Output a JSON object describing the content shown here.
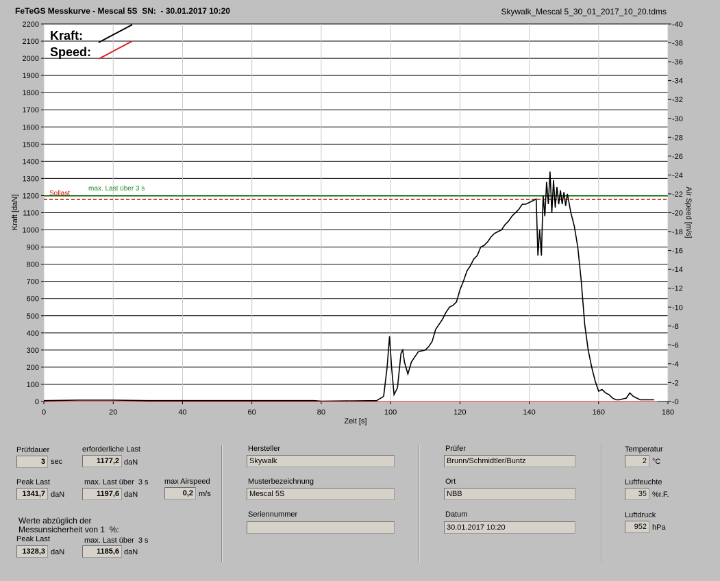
{
  "header": {
    "title": "FeTeGS Messkurve - Mescal 5S  SN:  - 30.01.2017 10:20",
    "filename": "Skywalk_Mescal 5_30_01_2017_10_20.tdms"
  },
  "chart_data": {
    "type": "line",
    "xlabel": "Zeit [s]",
    "ylabel": "Kraft [daN]",
    "y2label": "Air Speed [m/s]",
    "xlim": [
      0,
      180
    ],
    "ylim": [
      0,
      2200
    ],
    "y2lim": [
      0,
      40
    ],
    "x_ticks": [
      0,
      20,
      40,
      60,
      80,
      100,
      120,
      140,
      160,
      180
    ],
    "y_ticks": [
      0,
      100,
      200,
      300,
      400,
      500,
      600,
      700,
      800,
      900,
      1000,
      1100,
      1200,
      1300,
      1400,
      1500,
      1600,
      1700,
      1800,
      1900,
      2000,
      2100,
      2200
    ],
    "y2_ticks": [
      0,
      2,
      4,
      6,
      8,
      10,
      12,
      14,
      16,
      18,
      20,
      22,
      24,
      26,
      28,
      30,
      32,
      34,
      36,
      38,
      40
    ],
    "grid": true,
    "legend": {
      "entries": [
        {
          "label": "Kraft:",
          "color": "#000000"
        },
        {
          "label": "Speed:",
          "color": "#e02020"
        }
      ],
      "placement": "top-left"
    },
    "reference_lines": [
      {
        "label": "Sollast",
        "value": 1177.2,
        "color": "#cc1111",
        "style": "dashed"
      },
      {
        "label": "max. Last über  3 s",
        "value": 1197.6,
        "color": "#1a8a1a",
        "style": "solid"
      }
    ],
    "series": [
      {
        "name": "Kraft",
        "color": "#000000",
        "points": [
          [
            0,
            5
          ],
          [
            10,
            8
          ],
          [
            20,
            8
          ],
          [
            30,
            5
          ],
          [
            40,
            5
          ],
          [
            60,
            5
          ],
          [
            78,
            5
          ],
          [
            80,
            2
          ],
          [
            96,
            5
          ],
          [
            98,
            30
          ],
          [
            99,
            200
          ],
          [
            99.7,
            380
          ],
          [
            100.3,
            200
          ],
          [
            101,
            40
          ],
          [
            102,
            80
          ],
          [
            103,
            280
          ],
          [
            103.5,
            300
          ],
          [
            104,
            230
          ],
          [
            105,
            160
          ],
          [
            106,
            230
          ],
          [
            107,
            260
          ],
          [
            108,
            290
          ],
          [
            110,
            300
          ],
          [
            111,
            320
          ],
          [
            112,
            350
          ],
          [
            113,
            420
          ],
          [
            114,
            450
          ],
          [
            115,
            480
          ],
          [
            116,
            520
          ],
          [
            117,
            550
          ],
          [
            118,
            560
          ],
          [
            119,
            580
          ],
          [
            120,
            650
          ],
          [
            121,
            700
          ],
          [
            122,
            760
          ],
          [
            123,
            790
          ],
          [
            124,
            830
          ],
          [
            125,
            850
          ],
          [
            126,
            900
          ],
          [
            127,
            910
          ],
          [
            128,
            930
          ],
          [
            129,
            960
          ],
          [
            130,
            980
          ],
          [
            131,
            990
          ],
          [
            132,
            1000
          ],
          [
            133,
            1030
          ],
          [
            134,
            1050
          ],
          [
            135,
            1080
          ],
          [
            136,
            1100
          ],
          [
            137,
            1120
          ],
          [
            138,
            1150
          ],
          [
            139,
            1150
          ],
          [
            140,
            1160
          ],
          [
            141,
            1170
          ],
          [
            142,
            1180
          ],
          [
            142.5,
            850
          ],
          [
            143,
            1000
          ],
          [
            143.5,
            850
          ],
          [
            144,
            1200
          ],
          [
            144.5,
            1080
          ],
          [
            145,
            1280
          ],
          [
            145.5,
            1150
          ],
          [
            146,
            1340
          ],
          [
            146.5,
            1100
          ],
          [
            147,
            1290
          ],
          [
            147.5,
            1130
          ],
          [
            148,
            1250
          ],
          [
            148.5,
            1150
          ],
          [
            149,
            1230
          ],
          [
            149.5,
            1150
          ],
          [
            150,
            1220
          ],
          [
            150.5,
            1140
          ],
          [
            151,
            1210
          ],
          [
            152,
            1100
          ],
          [
            153,
            1020
          ],
          [
            154,
            900
          ],
          [
            155,
            700
          ],
          [
            156,
            450
          ],
          [
            157,
            300
          ],
          [
            158,
            200
          ],
          [
            159,
            120
          ],
          [
            160,
            60
          ],
          [
            161,
            70
          ],
          [
            162,
            50
          ],
          [
            163,
            40
          ],
          [
            164,
            20
          ],
          [
            165,
            10
          ],
          [
            166,
            10
          ],
          [
            168,
            20
          ],
          [
            169,
            50
          ],
          [
            170,
            30
          ],
          [
            171,
            20
          ],
          [
            172,
            10
          ],
          [
            176,
            10
          ]
        ]
      },
      {
        "name": "Speed",
        "color": "#e02020",
        "points": [
          [
            0,
            0
          ],
          [
            177,
            0
          ]
        ]
      }
    ]
  },
  "panel": {
    "pruefdauer": {
      "label": "Prüfdauer",
      "value": "3",
      "unit": "sec"
    },
    "erf_last": {
      "label": "erforderliche Last",
      "value": "1177,2",
      "unit": "daN"
    },
    "peak_last": {
      "label": "Peak Last",
      "value": "1341,7",
      "unit": "daN"
    },
    "max_last": {
      "label": "max. Last über  3 s",
      "value": "1197,6",
      "unit": "daN"
    },
    "max_airspeed": {
      "label": "max Airspeed",
      "value": "0,2",
      "unit": "m/s"
    },
    "werte_note": "Werte abzüglich der\nMessunsicherheit von 1  %:",
    "peak_last2": {
      "label": "Peak Last",
      "value": "1328,3",
      "unit": "daN"
    },
    "max_last2": {
      "label": "max. Last über  3 s",
      "value": "1185,6",
      "unit": "daN"
    },
    "hersteller": {
      "label": "Hersteller",
      "value": "Skywalk"
    },
    "muster": {
      "label": "Musterbezeichnung",
      "value": "Mescal 5S"
    },
    "serien": {
      "label": "Seriennummer",
      "value": ""
    },
    "pruefer": {
      "label": "Prüfer",
      "value": "Brunn/Schmidtler/Buntz"
    },
    "ort": {
      "label": "Ort",
      "value": "NBB"
    },
    "datum": {
      "label": "Datum",
      "value": "30.01.2017 10:20"
    },
    "temperatur": {
      "label": "Temperatur",
      "value": "2",
      "unit": "°C"
    },
    "luftfeuchte": {
      "label": "Luftfeuchte",
      "value": "35",
      "unit": "%r.F."
    },
    "luftdruck": {
      "label": "Luftdruck",
      "value": "952",
      "unit": "hPa"
    }
  }
}
